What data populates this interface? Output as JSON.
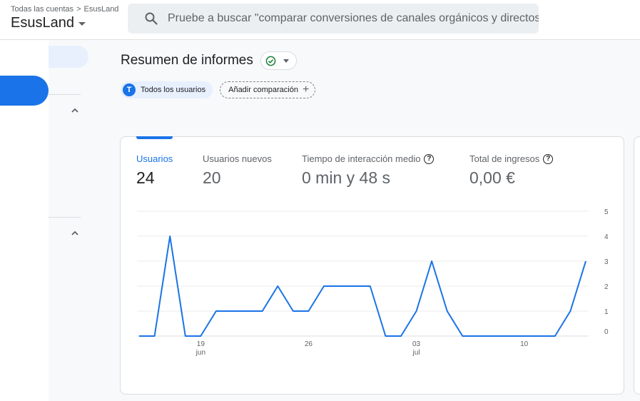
{
  "header": {
    "breadcrumb": [
      "Todas las cuentas",
      "EsusLand"
    ],
    "breadcrumb_separator": ">",
    "account_name": "EsusLand",
    "search_placeholder": "Pruebe a buscar \"comparar conversiones de canales orgánicos y directos\""
  },
  "page": {
    "title": "Resumen de informes",
    "status_icon": "check-circle-icon",
    "chips": {
      "user_avatar": "T",
      "user_label": "Todos los usuarios",
      "add_label": "Añadir comparación"
    }
  },
  "metrics": [
    {
      "label": "Usuarios",
      "value": "24",
      "help": false
    },
    {
      "label": "Usuarios nuevos",
      "value": "20",
      "help": false
    },
    {
      "label": "Tiempo de interacción medio",
      "value": "0 min y 48 s",
      "help": true
    },
    {
      "label": "Total de ingresos",
      "value": "0,00 €",
      "help": true
    }
  ],
  "colors": {
    "accent": "#1a73e8",
    "line": "#1a73e8",
    "success": "#188038"
  },
  "chart_data": {
    "type": "line",
    "series": [
      {
        "values": [
          0,
          0,
          4,
          0,
          0,
          1,
          1,
          1,
          1,
          2,
          1,
          1,
          2,
          2,
          2,
          2,
          0,
          0,
          1,
          3,
          1,
          0,
          0,
          0,
          0,
          0,
          0,
          0,
          1,
          3
        ]
      }
    ],
    "x_ticks": [
      {
        "index": 4,
        "day": "19",
        "month": "jun"
      },
      {
        "index": 11,
        "day": "26",
        "month": ""
      },
      {
        "index": 18,
        "day": "03",
        "month": "jul"
      },
      {
        "index": 25,
        "day": "10",
        "month": ""
      }
    ],
    "y_ticks": [
      0,
      1,
      2,
      3,
      4,
      5
    ],
    "ylim": [
      0,
      5
    ],
    "grid": true
  }
}
